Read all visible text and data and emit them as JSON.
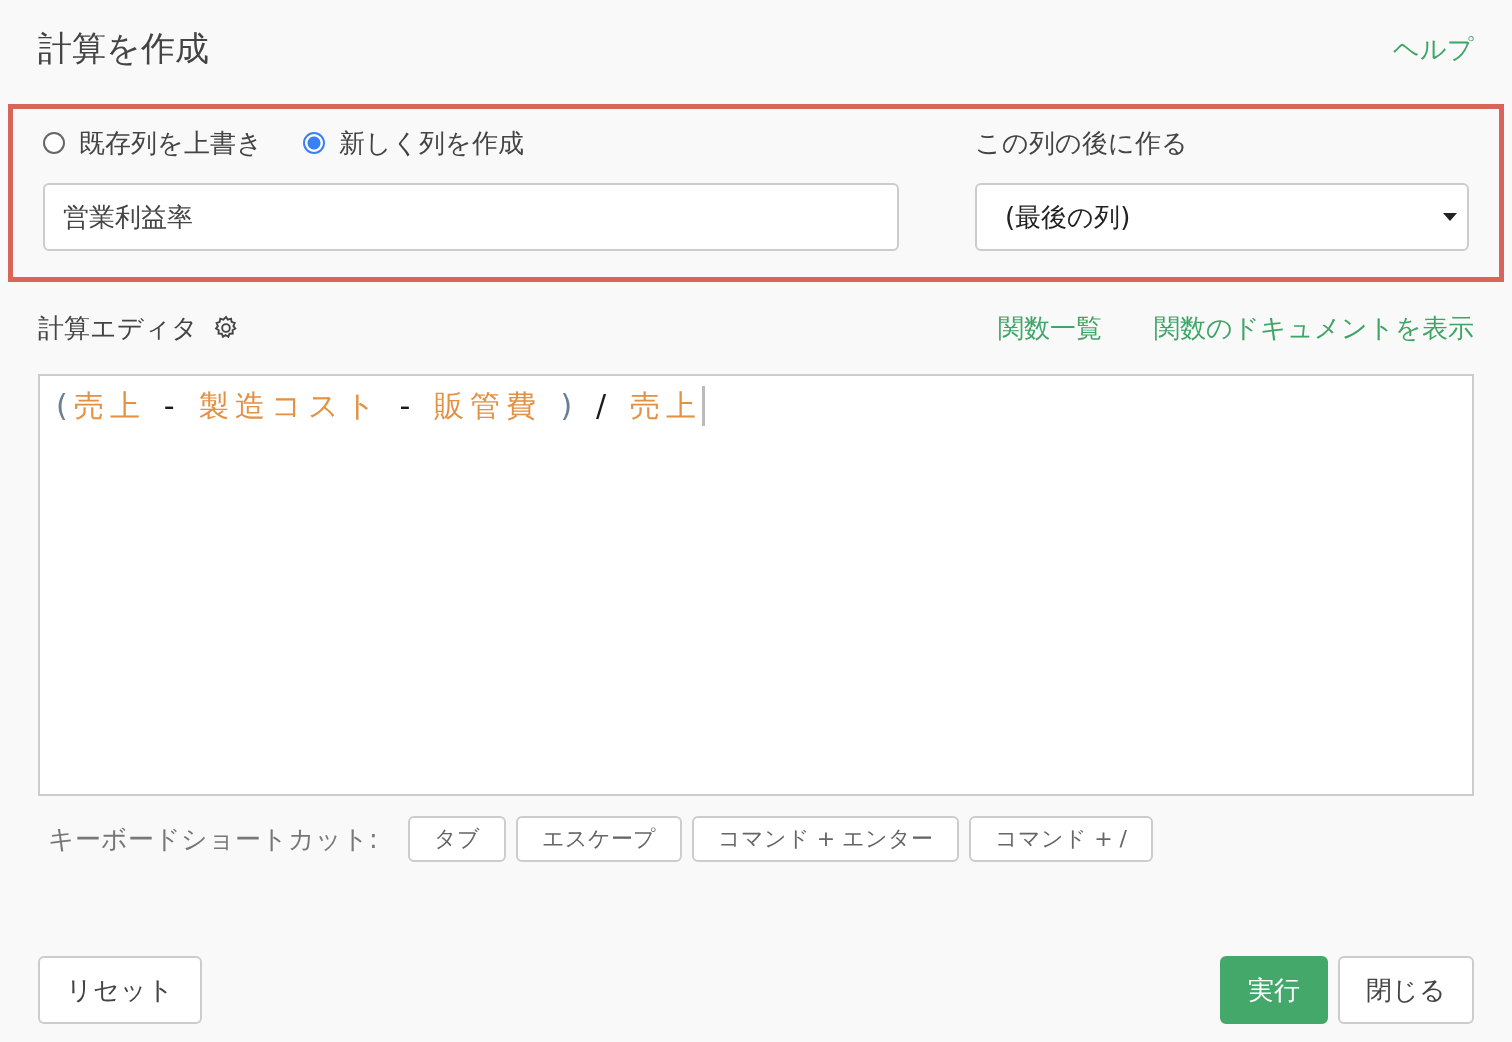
{
  "header": {
    "title": "計算を作成",
    "help_link": "ヘルプ"
  },
  "target": {
    "modes": [
      {
        "label": "既存列を上書き",
        "selected": false
      },
      {
        "label": "新しく列を作成",
        "selected": true
      }
    ],
    "name_field": {
      "value": "営業利益率"
    },
    "position_label": "この列の後に作る",
    "position_select": {
      "value": "(最後の列)"
    }
  },
  "editor": {
    "label": "計算エディタ",
    "links": [
      "関数一覧",
      "関数のドキュメントを表示"
    ],
    "tokens": [
      {
        "kind": "paren",
        "text": "("
      },
      {
        "kind": "column",
        "text": "売上"
      },
      {
        "kind": "operator",
        "text": "-"
      },
      {
        "kind": "column",
        "text": "製造コスト"
      },
      {
        "kind": "operator",
        "text": "-"
      },
      {
        "kind": "column",
        "text": "販管費"
      },
      {
        "kind": "paren",
        "text": ")"
      },
      {
        "kind": "operator",
        "text": "/"
      },
      {
        "kind": "column",
        "text": "売上"
      }
    ]
  },
  "shortcuts": {
    "label": "キーボードショートカット:",
    "keys": [
      "タブ",
      "エスケープ",
      "コマンド + エンター",
      "コマンド + /"
    ]
  },
  "footer": {
    "reset_button": "リセット",
    "run_button": "実行",
    "close_button": "閉じる"
  }
}
